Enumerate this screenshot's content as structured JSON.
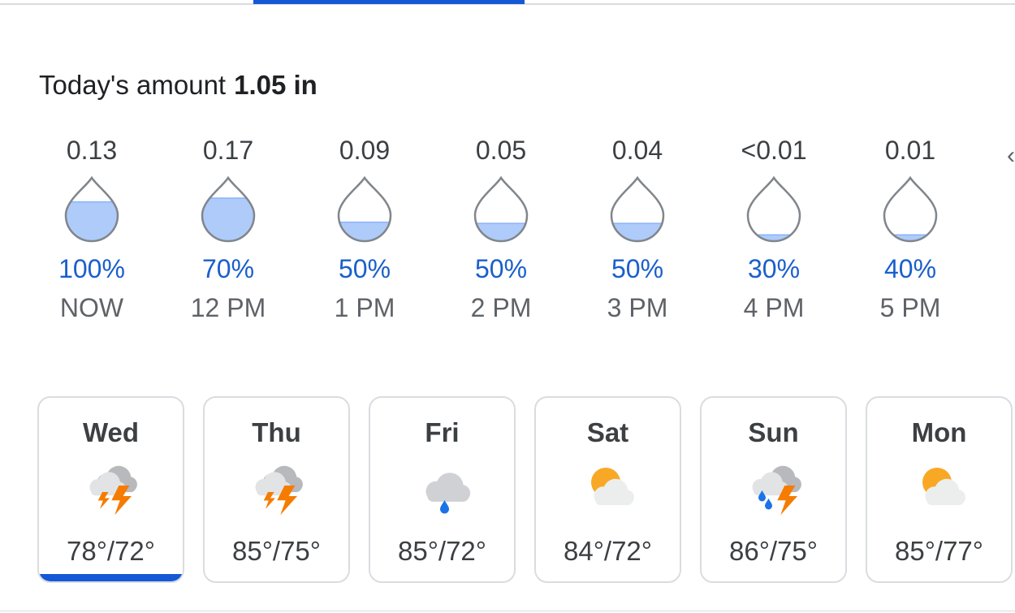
{
  "header": {
    "amount_label": "Today's amount",
    "amount_value": "1.05 in"
  },
  "hourly": [
    {
      "amount": "0.13",
      "probability": "100%",
      "time": "NOW",
      "fill": 0.62
    },
    {
      "amount": "0.17",
      "probability": "70%",
      "time": "12 PM",
      "fill": 0.68
    },
    {
      "amount": "0.09",
      "probability": "50%",
      "time": "1 PM",
      "fill": 0.3
    },
    {
      "amount": "0.05",
      "probability": "50%",
      "time": "2 PM",
      "fill": 0.28
    },
    {
      "amount": "0.04",
      "probability": "50%",
      "time": "3 PM",
      "fill": 0.28
    },
    {
      "amount": "<0.01",
      "probability": "30%",
      "time": "4 PM",
      "fill": 0.1
    },
    {
      "amount": "0.01",
      "probability": "40%",
      "time": "5 PM",
      "fill": 0.1
    }
  ],
  "overflow_glyph": "‹",
  "days": [
    {
      "day": "Wed",
      "temps": "78°/72°",
      "icon": "thunderstorm-icon",
      "selected": true
    },
    {
      "day": "Thu",
      "temps": "85°/75°",
      "icon": "thunderstorm-icon",
      "selected": false
    },
    {
      "day": "Fri",
      "temps": "85°/72°",
      "icon": "rain-cloud-icon",
      "selected": false
    },
    {
      "day": "Sat",
      "temps": "84°/72°",
      "icon": "partly-cloudy-icon",
      "selected": false
    },
    {
      "day": "Sun",
      "temps": "86°/75°",
      "icon": "scattered-thunderstorm-icon",
      "selected": false
    },
    {
      "day": "Mon",
      "temps": "85°/77°",
      "icon": "partly-cloudy-icon",
      "selected": false
    }
  ],
  "colors": {
    "accent": "#1558d6",
    "probability_text": "#1a5fcc",
    "drop_fill": "#aecbfa",
    "drop_outline": "#80868b",
    "cloud": "#dadce0",
    "sun": "#f9a825",
    "bolt": "#f57c00",
    "rain": "#1a73e8"
  }
}
